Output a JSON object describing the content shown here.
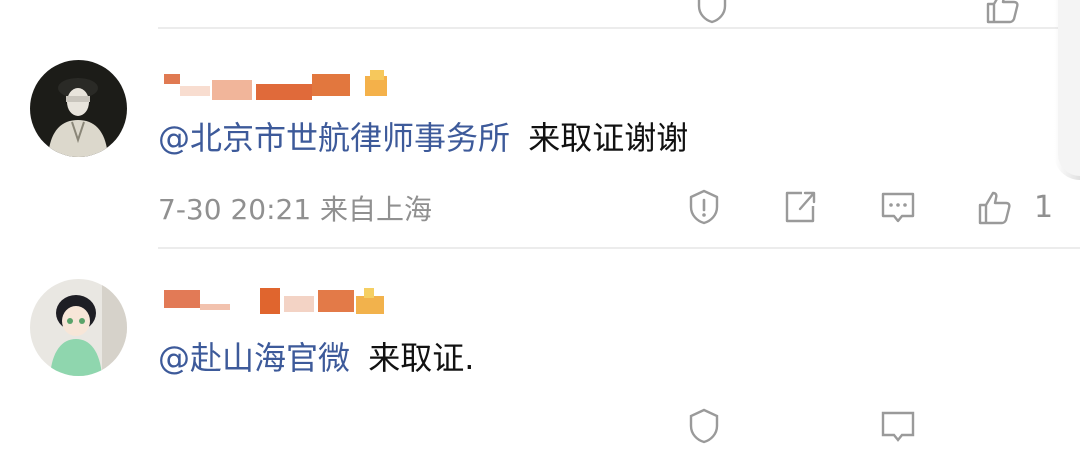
{
  "comments": [
    {
      "mention": "@北京市世航律师事务所",
      "text": "来取证谢谢",
      "meta": "7-30 20:21 来自上海",
      "like_count": "1"
    },
    {
      "mention": "@赴山海官微",
      "text": "来取证."
    }
  ],
  "icons": {
    "report": "exclamation-shield-icon",
    "share": "share-box-icon",
    "comment": "comment-bubble-icon",
    "like": "thumbs-up-icon"
  }
}
